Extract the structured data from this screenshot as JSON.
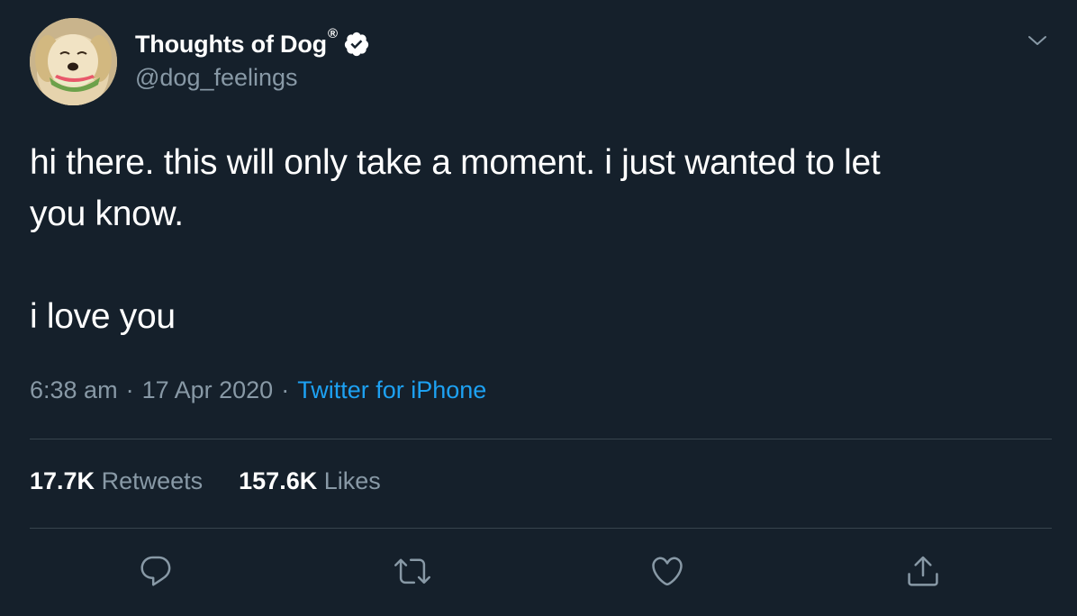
{
  "author": {
    "display_name": "Thoughts of Dog",
    "registered_mark": "®",
    "handle": "@dog_feelings",
    "verified": true,
    "avatar_icon": "dog-avatar"
  },
  "tweet": {
    "line1": "hi there. this will only take a moment. i just wanted to let",
    "line2": "you know.",
    "line3": "i love you"
  },
  "meta": {
    "time": "6:38 am",
    "separator": "·",
    "date": "17 Apr 2020",
    "source": "Twitter for iPhone"
  },
  "stats": {
    "retweets_count": "17.7K",
    "retweets_label": "Retweets",
    "likes_count": "157.6K",
    "likes_label": "Likes"
  },
  "actions": [
    "reply-icon",
    "retweet-icon",
    "like-icon",
    "share-icon"
  ],
  "colors": {
    "background": "#15202b",
    "secondary_text": "#8899a6",
    "link": "#1da1f2",
    "divider": "#38444d"
  }
}
